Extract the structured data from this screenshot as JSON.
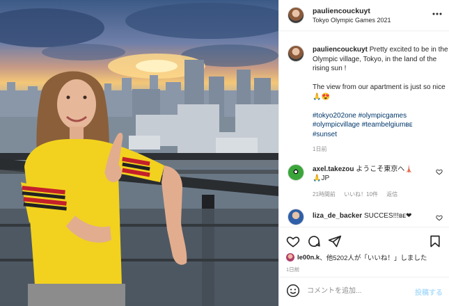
{
  "post": {
    "username": "pauliencouckuyt",
    "location": "Tokyo Olympic Games 2021"
  },
  "caption": {
    "username": "pauliencouckuyt",
    "line1": "Pretty excited to be in the Olympic village, Tokyo, in the land of the rising sun !",
    "line2": "The view from our apartment is just so nice 🙏😍",
    "hashtags": [
      "#tokyo202one",
      "#olympicgames",
      "#olympicvillage",
      "#teambelgiumʙᴇ",
      "#sunset"
    ],
    "age": "1日前"
  },
  "comments": [
    {
      "username": "axel.takezou",
      "text": "ようこそ東京へ🗼",
      "text2": "🙏JP",
      "time": "21時間前",
      "likes": "いいね！10件",
      "reply": "返信"
    },
    {
      "username": "liza_de_backer",
      "text": "SUCCES!!!ʙᴇ❤"
    }
  ],
  "actions": {
    "liked_by": "le00n.k",
    "likes_text": "、他5202人が「いいね！」しました",
    "date": "1日前"
  },
  "add_comment": {
    "placeholder": "コメントを追加...",
    "post_label": "投稿する"
  },
  "icons": {
    "more": "more-horizontal-icon",
    "heart": "heart-icon",
    "comment": "comment-icon",
    "share": "share-icon",
    "save": "bookmark-icon",
    "emoji": "emoji-icon"
  }
}
